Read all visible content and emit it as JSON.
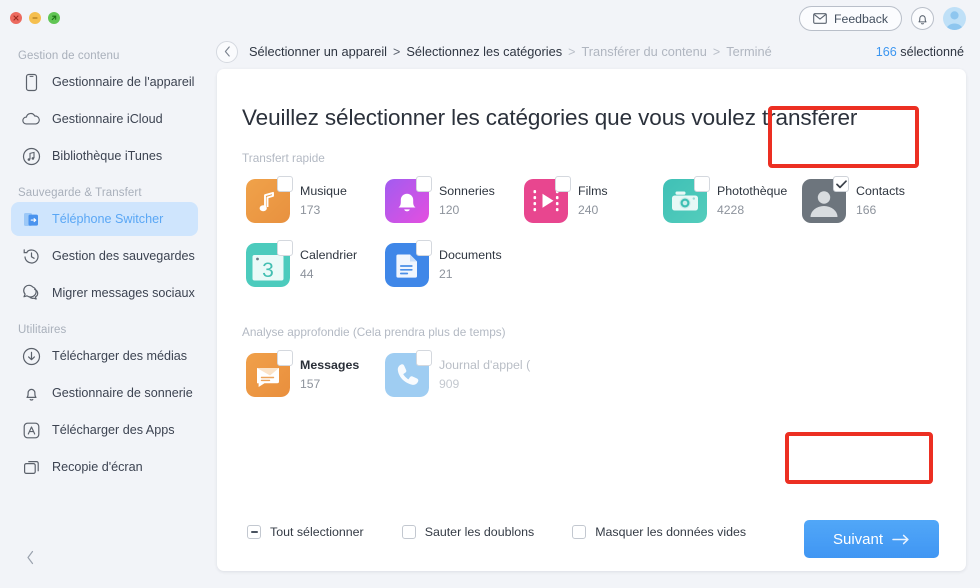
{
  "window": {
    "traffic_lights": [
      "close-button",
      "minimize-button",
      "maximize-button"
    ]
  },
  "sidebar": {
    "sections": [
      {
        "title": "Gestion de contenu",
        "items": [
          {
            "label": "Gestionnaire de l'appareil",
            "icon": "phone-icon",
            "active": false
          },
          {
            "label": "Gestionnaire iCloud",
            "icon": "cloud-icon",
            "active": false
          },
          {
            "label": "Bibliothèque iTunes",
            "icon": "music-note-circle-icon",
            "active": false
          }
        ]
      },
      {
        "title": "Sauvegarde & Transfert",
        "items": [
          {
            "label": "Téléphone Switcher",
            "icon": "phone-switch-icon",
            "active": true
          },
          {
            "label": "Gestion des sauvegardes",
            "icon": "clock-restore-icon",
            "active": false
          },
          {
            "label": "Migrer messages sociaux",
            "icon": "chat-bubbles-icon",
            "active": false
          }
        ]
      },
      {
        "title": "Utilitaires",
        "items": [
          {
            "label": "Télécharger des médias",
            "icon": "download-circle-icon",
            "active": false
          },
          {
            "label": "Gestionnaire de sonnerie",
            "icon": "bell-icon",
            "active": false
          },
          {
            "label": "Télécharger des Apps",
            "icon": "appstore-icon",
            "active": false
          },
          {
            "label": "Recopie d'écran",
            "icon": "screen-mirror-icon",
            "active": false
          }
        ]
      }
    ],
    "collapse_icon": "chevron-left-icon"
  },
  "topbar": {
    "feedback_label": "Feedback",
    "feedback_icon": "envelope-icon",
    "bell_icon": "bell-icon",
    "avatar_icon": "user-avatar-icon"
  },
  "breadcrumb": {
    "back_icon": "chevron-left-icon",
    "items": [
      {
        "label": "Sélectionner un appareil",
        "state": "done"
      },
      {
        "label": "Sélectionnez les catégories",
        "state": "current"
      },
      {
        "label": "Transférer du contenu",
        "state": "upcoming"
      },
      {
        "label": "Terminé",
        "state": "upcoming"
      }
    ],
    "separator": ">"
  },
  "selection": {
    "count": "166",
    "label": "sélectionné"
  },
  "main": {
    "title": "Veuillez sélectionner les catégories que vous voulez transférer",
    "quick_section_label": "Transfert rapide",
    "deep_section_label": "Analyse approfondie (Cela prendra plus de temps)",
    "quick_tiles": [
      {
        "name": "Musique",
        "count": "173",
        "icon": "music-icon",
        "checked": false,
        "disabled": false,
        "highlighted": false
      },
      {
        "name": "Sonneries",
        "count": "120",
        "icon": "ringtone-bell-icon",
        "checked": false,
        "disabled": false,
        "highlighted": false
      },
      {
        "name": "Films",
        "count": "240",
        "icon": "film-icon",
        "checked": false,
        "disabled": false,
        "highlighted": false
      },
      {
        "name": "Photothèque",
        "count": "4228",
        "icon": "camera-icon",
        "checked": false,
        "disabled": false,
        "highlighted": false
      },
      {
        "name": "Contacts",
        "count": "166",
        "icon": "contact-person-icon",
        "checked": true,
        "disabled": false,
        "highlighted": true
      },
      {
        "name": "Calendrier",
        "count": "44",
        "icon": "calendar-icon",
        "checked": false,
        "disabled": false,
        "highlighted": false
      },
      {
        "name": "Documents",
        "count": "21",
        "icon": "document-icon",
        "checked": false,
        "disabled": false,
        "highlighted": false
      }
    ],
    "deep_tiles": [
      {
        "name": "Messages",
        "count": "157",
        "icon": "message-icon",
        "checked": false,
        "disabled": false,
        "bold": true
      },
      {
        "name": "Journal d'appel (",
        "count": "909",
        "icon": "phone-call-icon",
        "checked": false,
        "disabled": true,
        "bold": false
      }
    ]
  },
  "footer": {
    "checkboxes": [
      {
        "label": "Tout sélectionner",
        "state": "indeterminate"
      },
      {
        "label": "Sauter les doublons",
        "state": "unchecked"
      },
      {
        "label": "Masquer les données vides",
        "state": "unchecked"
      }
    ],
    "next_label": "Suivant",
    "next_icon": "arrow-right-icon"
  },
  "colors": {
    "accent_blue": "#3c96f0",
    "highlight_red": "#ec2f22",
    "sidebar_bg": "#f2f4f8",
    "active_item_bg": "#cfe5fd"
  }
}
